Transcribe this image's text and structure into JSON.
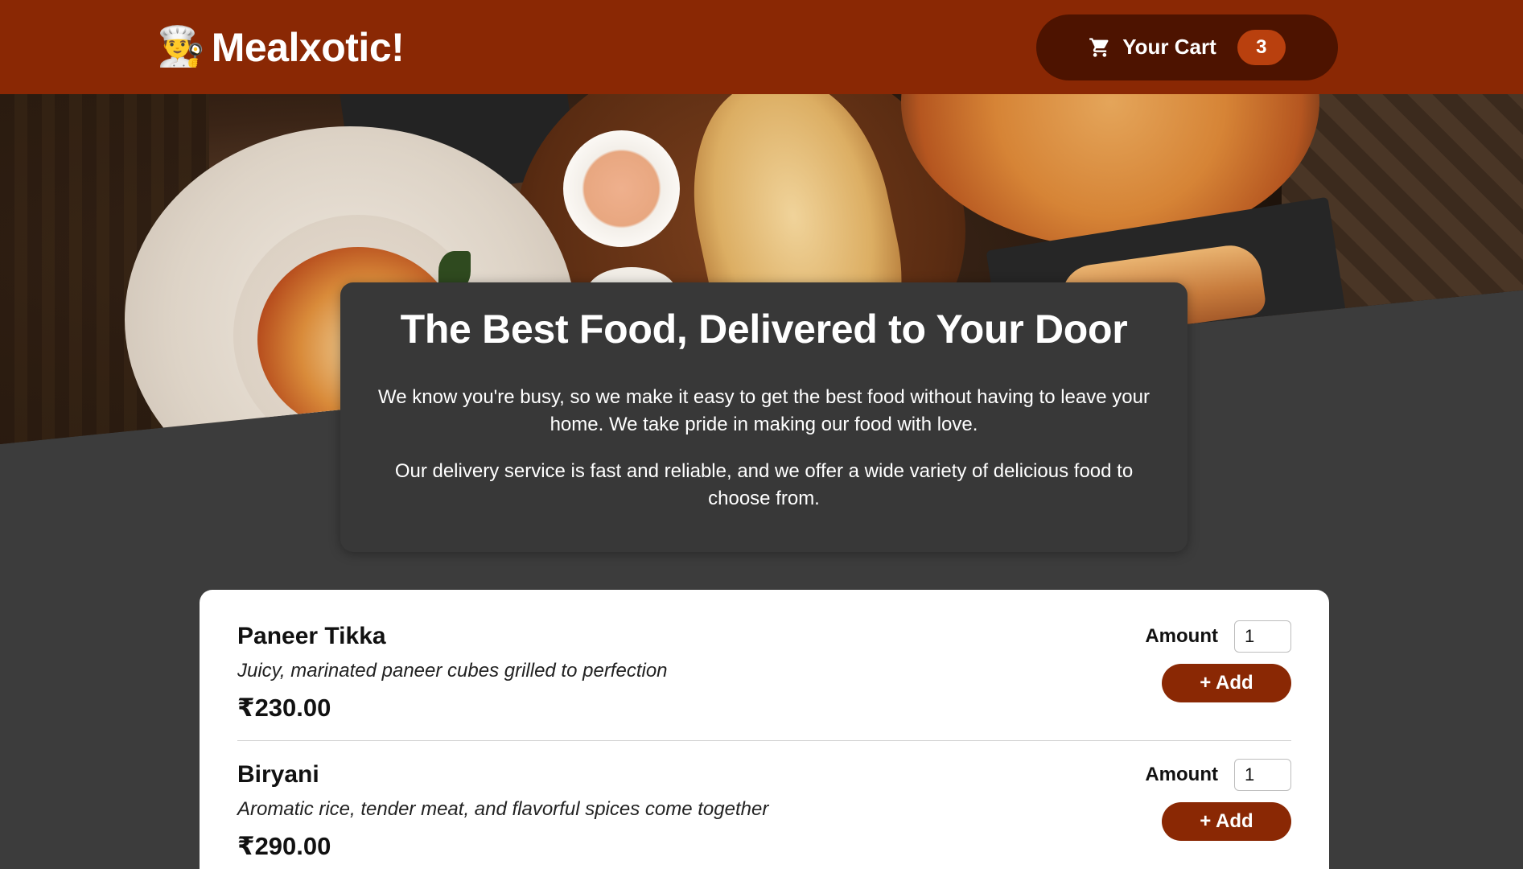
{
  "header": {
    "brand_title": "Mealxotic!",
    "brand_icon": "chef-emoji",
    "cart": {
      "label": "Your Cart",
      "count": "3",
      "icon": "cart-icon"
    }
  },
  "summary": {
    "heading": "The Best Food, Delivered to Your Door",
    "paragraph1": "We know you're busy, so we make it easy to get the best food without having to leave your home. We take pride in making our food with love.",
    "paragraph2": "Our delivery service is fast and reliable, and we offer a wide variety of delicious food to choose from."
  },
  "meals": [
    {
      "name": "Paneer Tikka",
      "description": "Juicy, marinated paneer cubes grilled to perfection",
      "price": "₹230.00",
      "amount_label": "Amount",
      "amount_value": "1",
      "add_label": "+ Add"
    },
    {
      "name": "Biryani",
      "description": "Aromatic rice, tender meat, and flavorful spices come together",
      "price": "₹290.00",
      "amount_label": "Amount",
      "amount_value": "1",
      "add_label": "+ Add"
    }
  ],
  "colors": {
    "header_bg": "#8a2804",
    "cart_button_bg": "#4d1300",
    "cart_badge_bg": "#b9400e",
    "page_bg": "#3c3c3c",
    "summary_bg": "#383838",
    "add_button_bg": "#8a2804"
  }
}
